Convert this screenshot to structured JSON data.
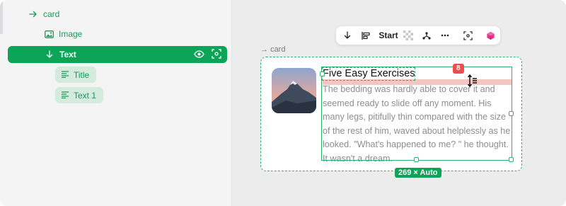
{
  "layers": {
    "card_label": "card",
    "image_label": "Image",
    "text_label": "Text",
    "children": [
      {
        "label": "Title"
      },
      {
        "label": "Text 1"
      }
    ]
  },
  "toolbar": {
    "start_label": "Start"
  },
  "canvas": {
    "card_label": "card",
    "title": "Five Easy Exercises",
    "body": "The bedding was hardly able to cover it and seemed ready to slide off any moment. His many legs, pitifully thin compared with the size of the rest of him, waved about helplessly as he looked. \"What's happened to me? \" he thought. It wasn't a dream.",
    "spacing_value": "8",
    "size_label": "269 × Auto"
  },
  "colors": {
    "accent": "#0ca457",
    "accent_text": "#1a9a5a",
    "chip_bg": "#d4ebdd",
    "spacing_red": "#ef4d4d",
    "spacing_band": "#f4c6c2"
  },
  "icons": [
    "arrow-right-icon",
    "image-icon",
    "arrow-down-icon",
    "eye-icon",
    "focus-icon",
    "text-lines-icon",
    "align-left-icon",
    "checker-icon",
    "fork-icon",
    "more-icon",
    "cube-icon",
    "resize-cursor-icon"
  ]
}
